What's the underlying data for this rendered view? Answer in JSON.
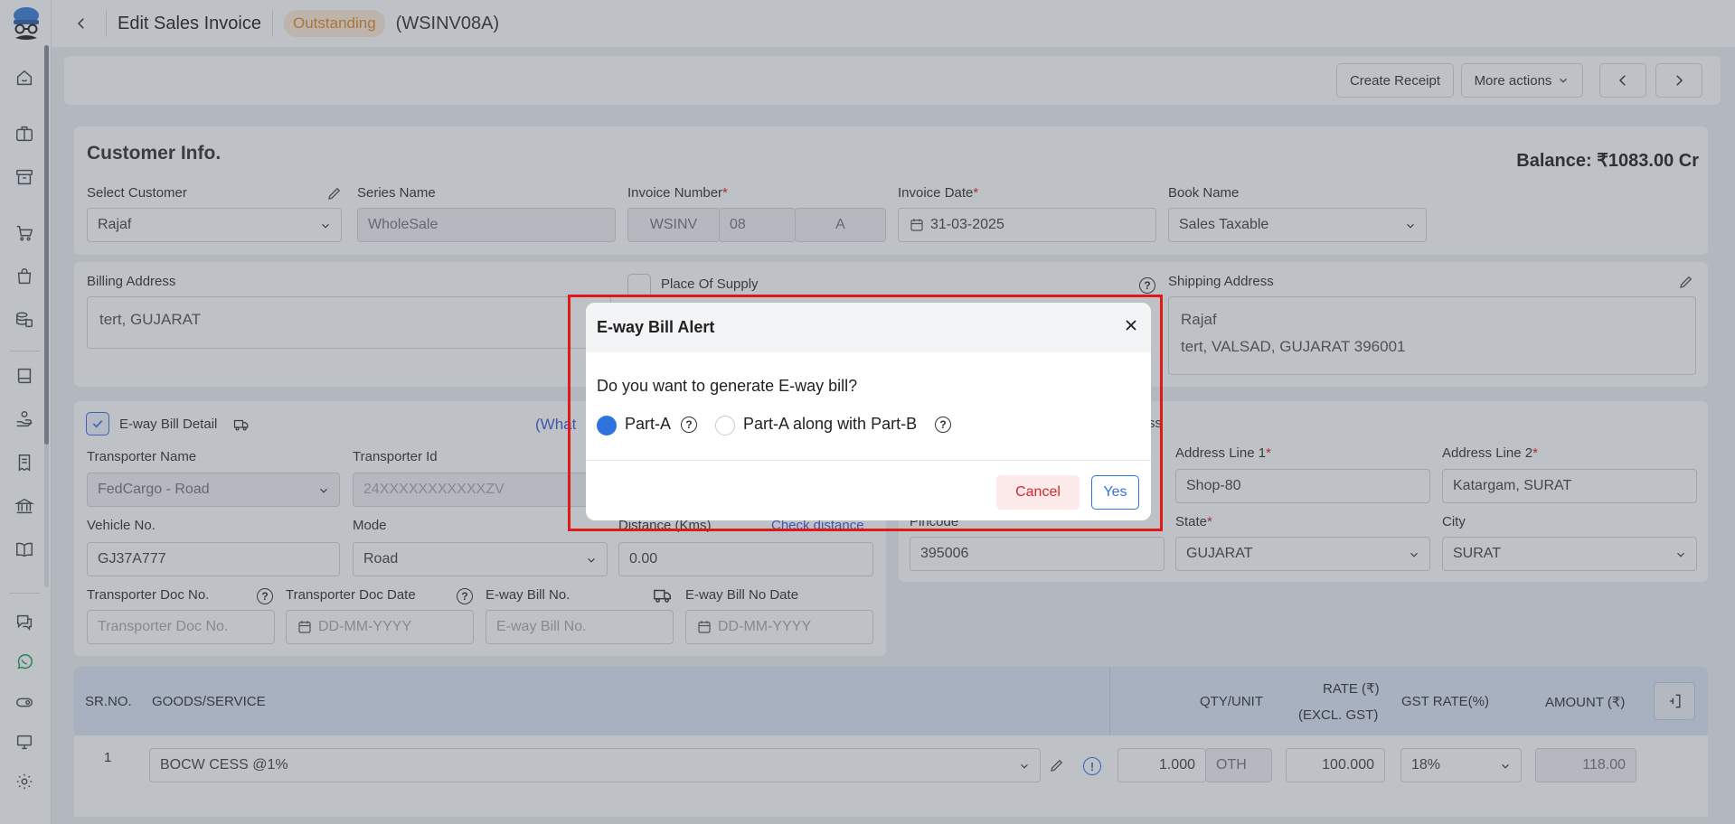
{
  "header": {
    "title": "Edit Sales Invoice",
    "status": "Outstanding",
    "invoice_code": "(WSINV08A)"
  },
  "actions": {
    "create_receipt": "Create Receipt",
    "more_actions": "More actions"
  },
  "customer_info": {
    "title": "Customer Info.",
    "balance": "Balance: ₹1083.00 Cr",
    "select_customer_label": "Select Customer",
    "select_customer_value": "Rajaf",
    "series_name_label": "Series Name",
    "series_name_value": "WholeSale",
    "invoice_number_label": "Invoice Number",
    "invoice_prefix": "WSINV",
    "invoice_no": "08",
    "invoice_suffix": "A",
    "invoice_date_label": "Invoice Date",
    "invoice_date_value": "31-03-2025",
    "book_name_label": "Book Name",
    "book_name_value": "Sales Taxable",
    "required_mark": "*"
  },
  "billing": {
    "label": "Billing Address",
    "value": "tert, GUJARAT",
    "place_of_supply_label": "Place Of Supply"
  },
  "shipping": {
    "label": "Shipping Address",
    "line1": "Rajaf",
    "line2": "tert, VALSAD, GUJARAT 396001"
  },
  "eway": {
    "detail_label": "E-way Bill Detail",
    "what_link": "(What",
    "transporter_name_label": "Transporter Name",
    "transporter_name_value": "FedCargo - Road",
    "transporter_id_label": "Transporter Id",
    "transporter_id_placeholder": "24XXXXXXXXXXXZV",
    "vehicle_no_label": "Vehicle No.",
    "vehicle_no_value": "GJ37A777",
    "mode_label": "Mode",
    "mode_value": "Road",
    "distance_label": "Distance (Kms)",
    "check_distance_link": "Check distance",
    "distance_value": "0.00",
    "doc_no_label": "Transporter Doc No.",
    "doc_no_placeholder": "Transporter Doc No.",
    "doc_date_label": "Transporter Doc Date",
    "doc_date_placeholder": "DD-MM-YYYY",
    "bill_no_label": "E-way Bill No.",
    "bill_no_placeholder": "E-way Bill No.",
    "bill_date_label": "E-way Bill No Date",
    "bill_date_placeholder": "DD-MM-YYYY"
  },
  "dispatch": {
    "partial_label": "ss",
    "address1_label": "Address Line 1",
    "address1_value": "Shop-80",
    "address2_label": "Address Line 2",
    "address2_value": "Katargam, SURAT",
    "pincode_label": "Pincode",
    "pincode_value": "395006",
    "state_label": "State",
    "state_value": "GUJARAT",
    "city_label": "City",
    "city_value": "SURAT"
  },
  "table": {
    "headers": [
      "SR.NO.",
      "GOODS/SERVICE",
      "QTY/UNIT",
      "RATE (₹)",
      "(EXCL. GST)",
      "GST RATE(%)",
      "AMOUNT (₹)"
    ],
    "row": {
      "sr": "1",
      "goods": "BOCW CESS @1%",
      "qty": "1.000",
      "unit": "OTH",
      "rate": "100.000",
      "gst": "18%",
      "amount": "118.00"
    }
  },
  "modal": {
    "title": "E-way Bill Alert",
    "question": "Do you want to generate E-way bill?",
    "option_a": "Part-A",
    "option_b": "Part-A along with Part-B",
    "cancel": "Cancel",
    "yes": "Yes",
    "selected": "Part-A"
  },
  "colors": {
    "accent": "#2f73de",
    "status": "#e08a2a",
    "danger": "#d7262b",
    "highlight": "#e01818"
  }
}
